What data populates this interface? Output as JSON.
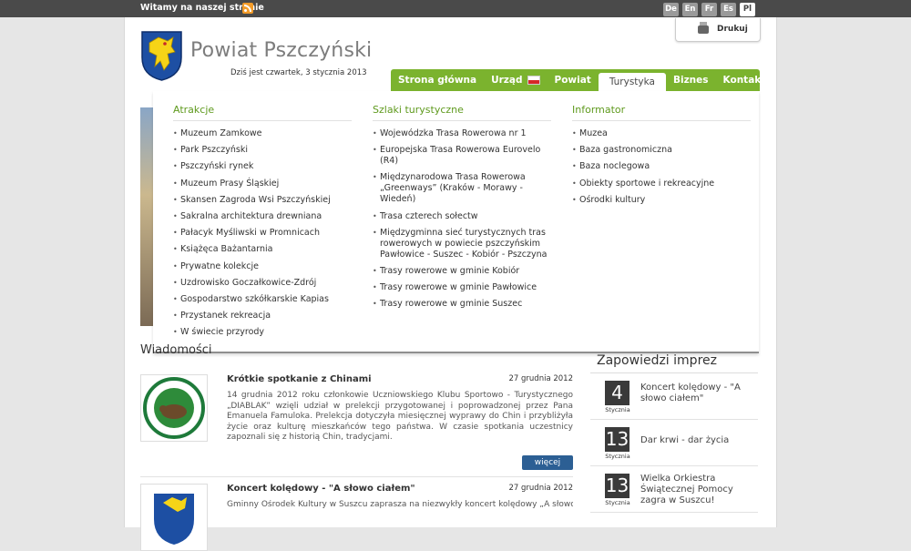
{
  "topbar": {
    "welcome": "Witamy na naszej stronie",
    "languages": [
      {
        "label": "De"
      },
      {
        "label": "En"
      },
      {
        "label": "Fr"
      },
      {
        "label": "Es"
      },
      {
        "label": "Pl",
        "active": true
      }
    ]
  },
  "header": {
    "print_label": "Drukuj",
    "title": "Powiat Pszczyński",
    "date": "Dziś jest czwartek, 3 stycznia 2013"
  },
  "nav": {
    "items": [
      {
        "label": "Strona główna"
      },
      {
        "label": "Urząd"
      },
      {
        "label": "Powiat"
      },
      {
        "label": "Turystyka"
      },
      {
        "label": "Biznes"
      },
      {
        "label": "Kontakt"
      }
    ]
  },
  "dropdown": {
    "columns": [
      {
        "heading": "Atrakcje",
        "items": [
          "Muzeum Zamkowe",
          "Park Pszczyński",
          "Pszczyński rynek",
          "Muzeum Prasy Śląskiej",
          "Skansen Zagroda Wsi Pszczyńskiej",
          "Sakralna architektura drewniana",
          "Pałacyk Myśliwski w Promnicach",
          "Książęca Bażantarnia",
          "Prywatne kolekcje",
          "Uzdrowisko Goczałkowice-Zdrój",
          "Gospodarstwo szkółkarskie Kapias",
          "Przystanek rekreacja",
          "W świecie przyrody"
        ]
      },
      {
        "heading": "Szlaki turystyczne",
        "items": [
          "Wojewódzka Trasa Rowerowa nr 1",
          "Europejska Trasa Rowerowa Eurovelo (R4)",
          "Międzynarodowa Trasa Rowerowa „Greenways” (Kraków - Morawy - Wiedeń)",
          "Trasa czterech sołectw",
          "Międzygminna sieć turystycznych tras rowerowych w powiecie pszczyńskim Pawłowice - Suszec - Kobiór - Pszczyna",
          "Trasy rowerowe w gminie Kobiór",
          "Trasy rowerowe w gminie Pawłowice",
          "Trasy rowerowe w gminie Suszec"
        ]
      },
      {
        "heading": "Informator",
        "items": [
          "Muzea",
          "Baza gastronomiczna",
          "Baza noclegowa",
          "Obiekty sportowe i rekreacyjne",
          "Ośrodki kultury"
        ]
      }
    ]
  },
  "news": {
    "heading": "Wiadomości",
    "items": [
      {
        "title": "Krótkie spotkanie z Chinami",
        "date": "27 grudnia 2012",
        "text": "14 grudnia 2012 roku członkowie Uczniowskiego Klubu Sportowo - Turystycznego „DIABLAK” wzięli udział w prelekcji przygotowanej i poprowadzonej przez Pana Emanuela Famuloka. Prelekcja dotyczyła miesięcznej wyprawy do Chin i przybliżyła życie oraz kulturę mieszkańców tego państwa. W czasie spotkania uczestnicy zapoznali się z historią Chin, tradycjami.",
        "more": "więcej"
      },
      {
        "title": "Koncert kolędowy - \"A słowo ciałem\"",
        "date": "27 grudnia 2012",
        "text": "Gminny Ośrodek Kultury w Suszcu zaprasza na niezwykły koncert kolędowy „A słowo"
      }
    ]
  },
  "events": {
    "heading": "Zapowiedzi imprez",
    "items": [
      {
        "day": "4",
        "month": "Stycznia",
        "title": "Koncert kolędowy - \"A słowo ciałem\""
      },
      {
        "day": "13",
        "month": "Stycznia",
        "title": "Dar krwi - dar życia"
      },
      {
        "day": "13",
        "month": "Stycznia",
        "title": "Wielka Orkiestra Świątecznej Pomocy zagra w Suszcu!"
      }
    ]
  },
  "colors": {
    "nav_green": "#7bb32e",
    "heading_green": "#5f9a1e",
    "more_button": "#2c5f94",
    "topbar": "#4a4a4a"
  }
}
